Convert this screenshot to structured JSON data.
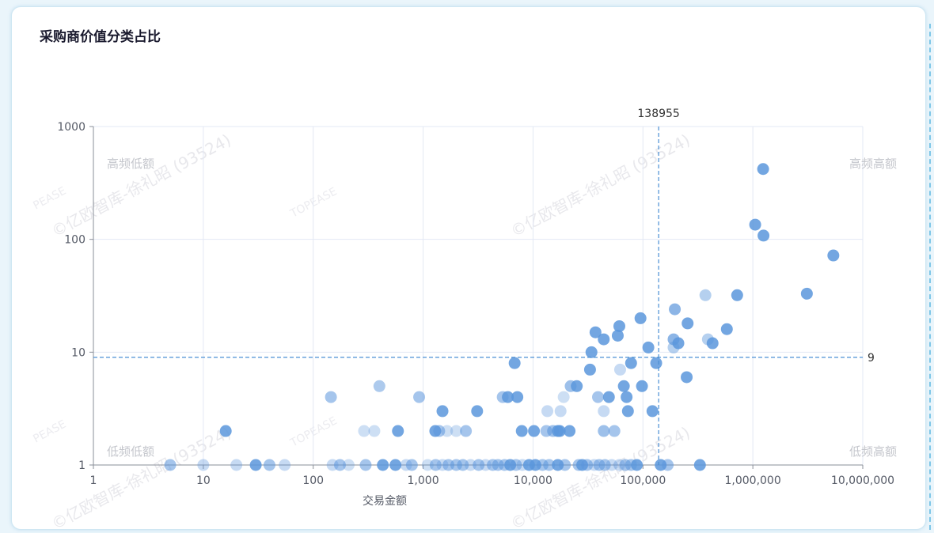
{
  "title": "采购商价值分类占比",
  "colors": {
    "dot_dark": "#5b96dc",
    "dot_light": "#b9d3f2",
    "mark_line": "#4a8fd4",
    "grid": "#e3e8f4",
    "axis": "#8a8f99"
  },
  "watermarks": {
    "main": "©亿欧智库-徐礼昭 (93524)",
    "brand_1": "PEASE",
    "brand_2": "TOPEASE"
  },
  "chart_data": {
    "type": "scatter",
    "title": "采购商价值分类占比",
    "xlabel": "交易金额",
    "ylabel": "",
    "x_scale": "log",
    "y_scale": "log",
    "xlim": [
      1,
      10000000
    ],
    "ylim": [
      1,
      1000
    ],
    "x_ticks": [
      "1",
      "10",
      "100",
      "1,000",
      "10,000",
      "100,000",
      "1,000,000",
      "10,000,000"
    ],
    "y_ticks": [
      "1",
      "10",
      "100",
      "1000"
    ],
    "grid": true,
    "mark_lines": {
      "x": 138955,
      "x_label": "138955",
      "y": 9,
      "y_label": "9"
    },
    "quadrants": {
      "top_left": "高频低额",
      "top_right": "高频高额",
      "bottom_left": "低频低额",
      "bottom_right": "低频高额"
    },
    "series": [
      {
        "x": 1240000,
        "y": 420,
        "o": 0.85
      },
      {
        "x": 1050000,
        "y": 135,
        "o": 0.85
      },
      {
        "x": 1250000,
        "y": 108,
        "o": 0.85
      },
      {
        "x": 5400000,
        "y": 72,
        "o": 0.85
      },
      {
        "x": 3100000,
        "y": 33,
        "o": 0.85
      },
      {
        "x": 720000,
        "y": 32,
        "o": 0.85
      },
      {
        "x": 370000,
        "y": 32,
        "o": 0.45
      },
      {
        "x": 195000,
        "y": 24,
        "o": 0.7
      },
      {
        "x": 255000,
        "y": 18,
        "o": 0.85
      },
      {
        "x": 95000,
        "y": 20,
        "o": 0.85
      },
      {
        "x": 61000,
        "y": 17,
        "o": 0.85
      },
      {
        "x": 37000,
        "y": 15,
        "o": 0.85
      },
      {
        "x": 59000,
        "y": 14,
        "o": 0.85
      },
      {
        "x": 44000,
        "y": 13,
        "o": 0.85
      },
      {
        "x": 190000,
        "y": 13,
        "o": 0.7
      },
      {
        "x": 210000,
        "y": 12,
        "o": 0.85
      },
      {
        "x": 390000,
        "y": 13,
        "o": 0.45
      },
      {
        "x": 430000,
        "y": 12,
        "o": 0.85
      },
      {
        "x": 580000,
        "y": 16,
        "o": 0.85
      },
      {
        "x": 190000,
        "y": 11,
        "o": 0.45
      },
      {
        "x": 112000,
        "y": 11,
        "o": 0.85
      },
      {
        "x": 34000,
        "y": 10,
        "o": 0.85
      },
      {
        "x": 78000,
        "y": 8,
        "o": 0.85
      },
      {
        "x": 132000,
        "y": 8,
        "o": 0.85
      },
      {
        "x": 6800,
        "y": 8,
        "o": 0.85
      },
      {
        "x": 33000,
        "y": 7,
        "o": 0.85
      },
      {
        "x": 62000,
        "y": 7,
        "o": 0.35
      },
      {
        "x": 250000,
        "y": 6,
        "o": 0.85
      },
      {
        "x": 22000,
        "y": 5,
        "o": 0.6
      },
      {
        "x": 25000,
        "y": 5,
        "o": 0.85
      },
      {
        "x": 67000,
        "y": 5,
        "o": 0.85
      },
      {
        "x": 98000,
        "y": 5,
        "o": 0.85
      },
      {
        "x": 400,
        "y": 5,
        "o": 0.5
      },
      {
        "x": 145,
        "y": 4,
        "o": 0.55
      },
      {
        "x": 920,
        "y": 4,
        "o": 0.55
      },
      {
        "x": 5300,
        "y": 4,
        "o": 0.55
      },
      {
        "x": 5900,
        "y": 4,
        "o": 0.85
      },
      {
        "x": 7200,
        "y": 4,
        "o": 0.85
      },
      {
        "x": 19000,
        "y": 4,
        "o": 0.3
      },
      {
        "x": 39000,
        "y": 4,
        "o": 0.55
      },
      {
        "x": 49000,
        "y": 4,
        "o": 0.85
      },
      {
        "x": 71000,
        "y": 4,
        "o": 0.85
      },
      {
        "x": 1500,
        "y": 3,
        "o": 0.85
      },
      {
        "x": 3100,
        "y": 3,
        "o": 0.85
      },
      {
        "x": 13500,
        "y": 3,
        "o": 0.35
      },
      {
        "x": 17800,
        "y": 3,
        "o": 0.35
      },
      {
        "x": 44000,
        "y": 3,
        "o": 0.35
      },
      {
        "x": 73000,
        "y": 3,
        "o": 0.85
      },
      {
        "x": 122000,
        "y": 3,
        "o": 0.85
      },
      {
        "x": 16,
        "y": 2,
        "o": 0.85
      },
      {
        "x": 290,
        "y": 2,
        "o": 0.3
      },
      {
        "x": 360,
        "y": 2,
        "o": 0.3
      },
      {
        "x": 590,
        "y": 2,
        "o": 0.85
      },
      {
        "x": 1290,
        "y": 2,
        "o": 0.85
      },
      {
        "x": 1400,
        "y": 2,
        "o": 0.55
      },
      {
        "x": 1650,
        "y": 2,
        "o": 0.3
      },
      {
        "x": 2000,
        "y": 2,
        "o": 0.3
      },
      {
        "x": 2450,
        "y": 2,
        "o": 0.55
      },
      {
        "x": 7900,
        "y": 2,
        "o": 0.85
      },
      {
        "x": 10200,
        "y": 2,
        "o": 0.85
      },
      {
        "x": 13200,
        "y": 2,
        "o": 0.55
      },
      {
        "x": 15200,
        "y": 2,
        "o": 0.6
      },
      {
        "x": 16800,
        "y": 2,
        "o": 0.85
      },
      {
        "x": 17500,
        "y": 2,
        "o": 0.85
      },
      {
        "x": 21500,
        "y": 2,
        "o": 0.85
      },
      {
        "x": 44000,
        "y": 2,
        "o": 0.6
      },
      {
        "x": 55000,
        "y": 2,
        "o": 0.55
      },
      {
        "x": 5,
        "y": 1,
        "o": 0.55
      },
      {
        "x": 10,
        "y": 1,
        "o": 0.35
      },
      {
        "x": 20,
        "y": 1,
        "o": 0.35
      },
      {
        "x": 30,
        "y": 1,
        "o": 0.85
      },
      {
        "x": 40,
        "y": 1,
        "o": 0.55
      },
      {
        "x": 55,
        "y": 1,
        "o": 0.35
      },
      {
        "x": 150,
        "y": 1,
        "o": 0.35
      },
      {
        "x": 175,
        "y": 1,
        "o": 0.55
      },
      {
        "x": 210,
        "y": 1,
        "o": 0.3
      },
      {
        "x": 300,
        "y": 1,
        "o": 0.55
      },
      {
        "x": 430,
        "y": 1,
        "o": 0.85
      },
      {
        "x": 560,
        "y": 1,
        "o": 0.85
      },
      {
        "x": 700,
        "y": 1,
        "o": 0.35
      },
      {
        "x": 790,
        "y": 1,
        "o": 0.55
      },
      {
        "x": 1100,
        "y": 1,
        "o": 0.3
      },
      {
        "x": 1300,
        "y": 1,
        "o": 0.55
      },
      {
        "x": 1500,
        "y": 1,
        "o": 0.35
      },
      {
        "x": 1700,
        "y": 1,
        "o": 0.55
      },
      {
        "x": 2000,
        "y": 1,
        "o": 0.55
      },
      {
        "x": 2300,
        "y": 1,
        "o": 0.55
      },
      {
        "x": 2700,
        "y": 1,
        "o": 0.35
      },
      {
        "x": 3200,
        "y": 1,
        "o": 0.55
      },
      {
        "x": 3700,
        "y": 1,
        "o": 0.35
      },
      {
        "x": 4300,
        "y": 1,
        "o": 0.55
      },
      {
        "x": 4800,
        "y": 1,
        "o": 0.55
      },
      {
        "x": 5500,
        "y": 1,
        "o": 0.55
      },
      {
        "x": 6200,
        "y": 1,
        "o": 0.85
      },
      {
        "x": 7000,
        "y": 1,
        "o": 0.55
      },
      {
        "x": 8000,
        "y": 1,
        "o": 0.35
      },
      {
        "x": 9200,
        "y": 1,
        "o": 0.85
      },
      {
        "x": 10500,
        "y": 1,
        "o": 0.85
      },
      {
        "x": 12200,
        "y": 1,
        "o": 0.55
      },
      {
        "x": 14000,
        "y": 1,
        "o": 0.55
      },
      {
        "x": 16800,
        "y": 1,
        "o": 0.85
      },
      {
        "x": 19500,
        "y": 1,
        "o": 0.55
      },
      {
        "x": 26000,
        "y": 1,
        "o": 0.55
      },
      {
        "x": 28000,
        "y": 1,
        "o": 0.85
      },
      {
        "x": 31000,
        "y": 1,
        "o": 0.55
      },
      {
        "x": 36000,
        "y": 1,
        "o": 0.35
      },
      {
        "x": 40000,
        "y": 1,
        "o": 0.55
      },
      {
        "x": 45000,
        "y": 1,
        "o": 0.55
      },
      {
        "x": 52000,
        "y": 1,
        "o": 0.35
      },
      {
        "x": 61000,
        "y": 1,
        "o": 0.35
      },
      {
        "x": 69000,
        "y": 1,
        "o": 0.55
      },
      {
        "x": 78000,
        "y": 1,
        "o": 0.55
      },
      {
        "x": 88000,
        "y": 1,
        "o": 0.85
      },
      {
        "x": 145000,
        "y": 1,
        "o": 0.85
      },
      {
        "x": 168000,
        "y": 1,
        "o": 0.55
      },
      {
        "x": 330000,
        "y": 1,
        "o": 0.85
      }
    ]
  }
}
